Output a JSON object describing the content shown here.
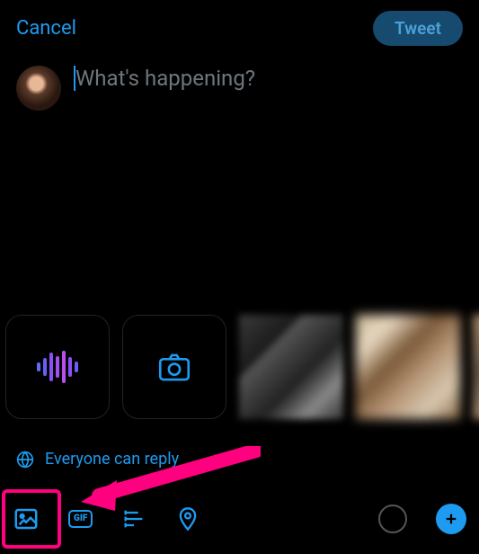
{
  "topbar": {
    "cancel": "Cancel",
    "tweet": "Tweet"
  },
  "composer": {
    "placeholder": "What's happening?"
  },
  "reply": {
    "label": "Everyone can reply"
  },
  "toolbar": {
    "gif_label": "GIF"
  },
  "media": {
    "audio_tile": "audio-wave",
    "camera_tile": "camera"
  }
}
